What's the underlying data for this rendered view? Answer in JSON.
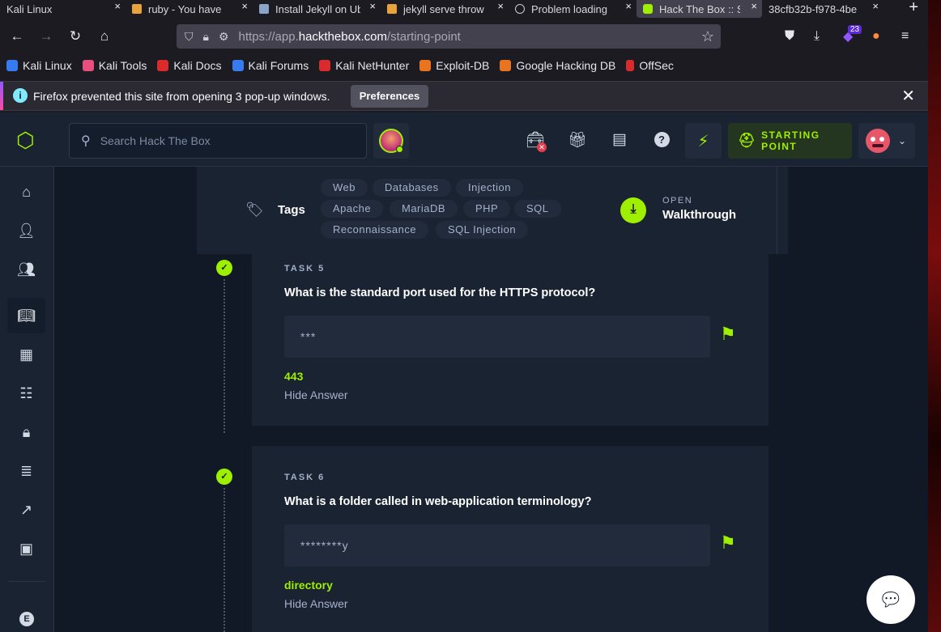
{
  "browser": {
    "tabs": [
      {
        "title": "Kali Linux",
        "close": "×",
        "color": "#2b2a33"
      },
      {
        "title": "ruby - You have",
        "close": "×",
        "color": "#e8a33d"
      },
      {
        "title": "Install Jekyll on Ub",
        "close": "×",
        "color": "#8aa4c8"
      },
      {
        "title": "jekyll serve throw",
        "close": "×",
        "color": "#e8a33d"
      },
      {
        "title": "Problem loading",
        "close": "×",
        "color": "#bbbbbb"
      },
      {
        "title": "Hack The Box :: S",
        "close": "×",
        "color": "#9fef00"
      },
      {
        "title": "38cfb32b-f978-4be",
        "close": "×",
        "color": "#2b2a33"
      }
    ],
    "new_tab": "+",
    "url_prefix": "https://app.",
    "url_domain": "hackthebox.com",
    "url_path": "/starting-point",
    "extension_badge": "23",
    "bookmarks": [
      {
        "label": "Kali Linux",
        "color": "#367bf0"
      },
      {
        "label": "Kali Tools",
        "color": "#e84f7c"
      },
      {
        "label": "Kali Docs",
        "color": "#d92b2b"
      },
      {
        "label": "Kali Forums",
        "color": "#367bf0"
      },
      {
        "label": "Kali NetHunter",
        "color": "#d92b2b"
      },
      {
        "label": "Exploit-DB",
        "color": "#e8741f"
      },
      {
        "label": "Google Hacking DB",
        "color": "#e8741f"
      },
      {
        "label": "OffSec",
        "color": "#d92b2b"
      }
    ],
    "notification": {
      "message": "Firefox prevented this site from opening 3 pop-up windows.",
      "button": "Preferences"
    }
  },
  "app": {
    "search_placeholder": "Search Hack The Box",
    "starting_point_label": "STARTING POINT",
    "accent": "#9fef00"
  },
  "tags_card": {
    "label": "Tags",
    "tags": [
      "Web",
      "Databases",
      "Injection",
      "Apache",
      "MariaDB",
      "PHP",
      "SQL",
      "Reconnaissance",
      "SQL Injection"
    ],
    "walkthrough_open": "OPEN",
    "walkthrough_title": "Walkthrough"
  },
  "tasks": [
    {
      "label": "TASK 5",
      "question": "What is the standard port used for the HTTPS protocol?",
      "masked": "***",
      "answer": "443",
      "hide": "Hide Answer"
    },
    {
      "label": "TASK 6",
      "question": "What is a folder called in web-application terminology?",
      "masked": "********y",
      "answer": "directory",
      "hide": "Hide Answer"
    }
  ],
  "sidebar_badge": "E"
}
